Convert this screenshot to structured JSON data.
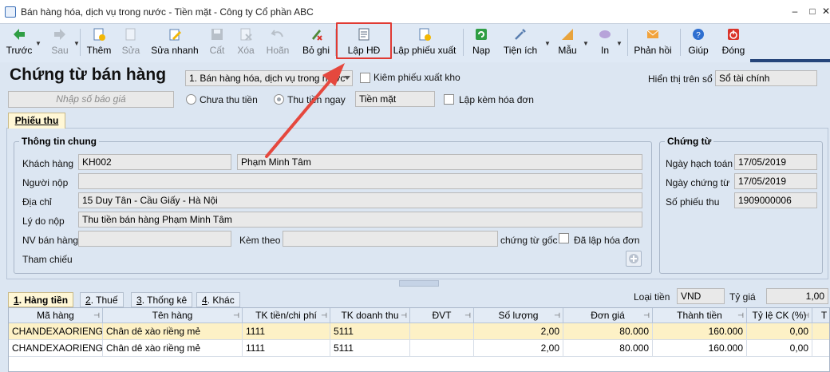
{
  "window": {
    "title": "Bán hàng hóa, dịch vụ trong nước - Tiền mặt - Công ty Cổ phần ABC",
    "minimize": "–",
    "maximize": "□",
    "close": "✕"
  },
  "toolbar": {
    "items": [
      {
        "label": "Trước",
        "icon": "arrow-left-icon"
      },
      {
        "label": "Sau",
        "icon": "arrow-right-icon"
      },
      {
        "label": "Thêm",
        "icon": "add-document-icon"
      },
      {
        "label": "Sửa",
        "icon": "edit-document-icon"
      },
      {
        "label": "Sửa nhanh",
        "icon": "quick-edit-icon"
      },
      {
        "label": "Cất",
        "icon": "save-icon"
      },
      {
        "label": "Xóa",
        "icon": "delete-icon"
      },
      {
        "label": "Hoãn",
        "icon": "undo-icon"
      },
      {
        "label": "Bỏ ghi",
        "icon": "unpost-icon"
      },
      {
        "label": "Lập HĐ",
        "icon": "invoice-icon"
      },
      {
        "label": "Lập phiếu xuất",
        "icon": "export-slip-icon"
      },
      {
        "label": "Nạp",
        "icon": "refresh-icon"
      },
      {
        "label": "Tiện ích",
        "icon": "tools-icon"
      },
      {
        "label": "Mẫu",
        "icon": "template-icon"
      },
      {
        "label": "In",
        "icon": "print-icon"
      },
      {
        "label": "Phản hồi",
        "icon": "mail-icon"
      },
      {
        "label": "Giúp",
        "icon": "help-icon"
      },
      {
        "label": "Đóng",
        "icon": "power-icon"
      }
    ]
  },
  "header": {
    "page_title": "Chứng từ bán hàng",
    "sale_type": "1. Bán hàng hóa, dịch vụ trong nước",
    "kiem_phieu_xuat_kho": "Kiêm phiếu xuất kho",
    "hien_thi_tren_so_label": "Hiển thị trên sổ",
    "hien_thi_tren_so_value": "Sổ tài chính",
    "quote_placeholder": "Nhập số báo giá",
    "chua_thu_tien": "Chưa thu tiền",
    "thu_tien_ngay": "Thu tiền ngay",
    "payment_method": "Tiền mặt",
    "lap_kem_hoa_don": "Lập kèm hóa đơn"
  },
  "tab": {
    "label": "Phiếu thu"
  },
  "general_info": {
    "title": "Thông tin chung",
    "khach_hang_label": "Khách hàng",
    "khach_hang_code": "KH002",
    "khach_hang_name": "Phạm Minh Tâm",
    "nguoi_nop_label": "Người nộp",
    "nguoi_nop_value": "",
    "dia_chi_label": "Địa chỉ",
    "dia_chi_value": "15 Duy Tân - Cầu Giấy - Hà Nội",
    "ly_do_label": "Lý do nộp",
    "ly_do_value": "Thu tiền bán hàng Phạm Minh Tâm",
    "nv_ban_hang_label": "NV bán hàng",
    "kem_theo_label": "Kèm theo",
    "chung_tu_goc": "chứng từ gốc",
    "da_lap_hoa_don": "Đã lập hóa đơn",
    "tham_chieu_label": "Tham chiếu"
  },
  "voucher": {
    "title": "Chứng từ",
    "ngay_hach_toan_label": "Ngày hạch toán",
    "ngay_hach_toan": "17/05/2019",
    "ngay_chung_tu_label": "Ngày chứng từ",
    "ngay_chung_tu": "17/05/2019",
    "so_phieu_thu_label": "Số phiếu thu",
    "so_phieu_thu": "1909000006"
  },
  "bottom_tabs": [
    {
      "key": "1",
      "label": ". Hàng tiền"
    },
    {
      "key": "2",
      "label": ". Thuế"
    },
    {
      "key": "3",
      "label": ". Thống kê"
    },
    {
      "key": "4",
      "label": ". Khác"
    }
  ],
  "currency": {
    "loai_tien_label": "Loại tiền",
    "loai_tien": "VND",
    "ty_gia_label": "Tỷ giá",
    "ty_gia": "1,00"
  },
  "grid": {
    "columns": [
      "Mã hàng",
      "Tên hàng",
      "TK tiền/chi phí",
      "TK doanh thu",
      "ĐVT",
      "Số lượng",
      "Đơn giá",
      "Thành tiền",
      "Tỷ lệ CK (%)",
      "T"
    ],
    "rows": [
      [
        "CHANDEXAORIENG",
        "Chân dê xào riềng mẻ",
        "1111",
        "5111",
        "",
        "2,00",
        "80.000",
        "160.000",
        "0,00"
      ],
      [
        "CHANDEXAORIENG",
        "Chân dê xào riềng mẻ",
        "1111",
        "5111",
        "",
        "2,00",
        "80.000",
        "160.000",
        "0,00"
      ]
    ]
  },
  "colors": {
    "highlight": "#e03a33",
    "arrow": "#e5483e",
    "selected_row": "#fdf1c6"
  }
}
